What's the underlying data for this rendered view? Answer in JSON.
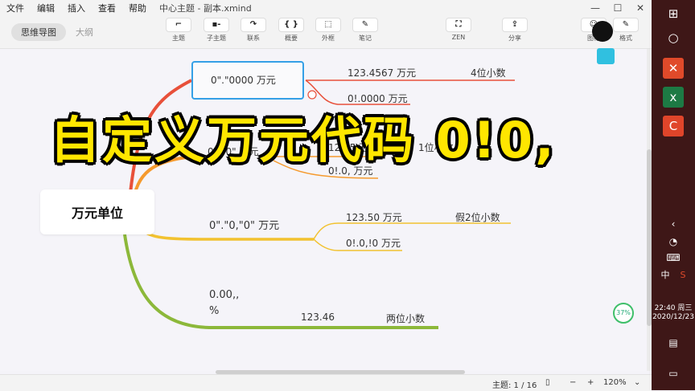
{
  "menu": {
    "items": [
      "文件",
      "编辑",
      "插入",
      "查看",
      "帮助"
    ],
    "doc_title": "中心主题 - 副本.xmind"
  },
  "window": {
    "minimize": "—",
    "maximize": "☐",
    "close": "✕"
  },
  "view_tabs": {
    "mindmap": "思维导图",
    "outline": "大纲"
  },
  "toolbar": {
    "topic": {
      "icon": "⌐",
      "label": "主题"
    },
    "subtopic": {
      "icon": "▪-",
      "label": "子主题"
    },
    "relation": {
      "icon": "↷",
      "label": "联系"
    },
    "summary": {
      "icon": "{ }",
      "label": "概要"
    },
    "boundary": {
      "icon": "⬚",
      "label": "外框"
    },
    "note": {
      "icon": "✎",
      "label": "笔记"
    },
    "zen": {
      "icon": "⛶",
      "label": "ZEN"
    },
    "share": {
      "icon": "⇪",
      "label": "分享"
    },
    "icon_btn": {
      "icon": "☺",
      "label": "图标"
    },
    "format": {
      "icon": "✎",
      "label": "格式"
    }
  },
  "mindmap": {
    "central": "万元单位",
    "b1": {
      "label": "0\".\"0000 万元",
      "c1": "123.4567 万元",
      "c1_note": "4位小数",
      "c2": "0!.0000 万元"
    },
    "b2": {
      "label": "0\".\"0\" 万元",
      "c1": "123.5 万元",
      "c1_note": "1位小数",
      "c2": "0!.0, 万元"
    },
    "b3": {
      "label": "0\".\"0,\"0\" 万元",
      "c1": "123.50 万元",
      "c1_note": "假2位小数",
      "c2": "0!.0,!0 万元"
    },
    "b4": {
      "label1": "0.00,,",
      "label2": "%",
      "c1": "123.46",
      "c1_note": "两位小数"
    }
  },
  "overlay_title": "自定义万元代码 0!0,",
  "gauge": "37%",
  "status": {
    "topics": "主题: 1 / 16",
    "zoom": "120%",
    "minus": "−",
    "plus": "+"
  },
  "taskbar": {
    "time": "22:40 周三",
    "date": "2020/12/23",
    "ime": "中",
    "ime2": "S"
  },
  "colors": {
    "red": "#e8503a",
    "orange": "#f59a2e",
    "yellow": "#f2c230",
    "green": "#8cb83a",
    "accent": "#35a0e6"
  }
}
